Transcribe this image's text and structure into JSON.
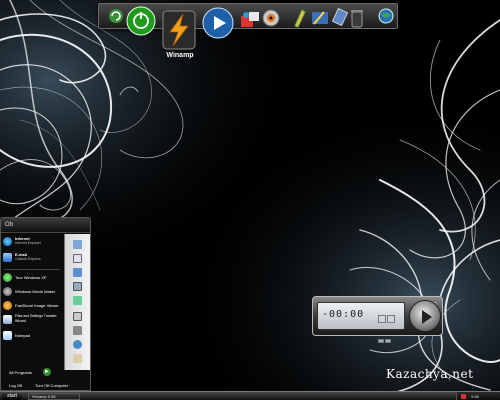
{
  "dock": {
    "label": "Winamp",
    "icons": [
      "refresh-icon",
      "green-orb-icon",
      "winamp-icon",
      "play-icon",
      "paint-icon",
      "cd-icon",
      "pencil-icon",
      "tools-icon",
      "usb-icon",
      "trash-icon",
      "globe-icon"
    ]
  },
  "start_menu": {
    "user_label": "Ob",
    "pinned": [
      {
        "title": "Internet",
        "subtitle": "Internet Explorer",
        "icon": "internet-explorer-icon"
      },
      {
        "title": "E-mail",
        "subtitle": "Outlook Express",
        "icon": "outlook-express-icon"
      }
    ],
    "recent": [
      {
        "label": "Tour Windows XP",
        "icon": "tour-icon"
      },
      {
        "label": "Windows Movie Maker",
        "icon": "movie-maker-icon"
      },
      {
        "label": "FastStone Image Viewer",
        "icon": "faststone-icon"
      },
      {
        "label": "Files and Settings Transfer Wizard",
        "icon": "transfer-wizard-icon"
      },
      {
        "label": "Notepad",
        "icon": "notepad-icon"
      }
    ],
    "all_programs": "All Programs",
    "log_off": "Log Off",
    "turn_off": "Turn Off Computer"
  },
  "player": {
    "time": "-00:00"
  },
  "taskbar": {
    "start_label": "start",
    "task_label": "Winamp 5.56",
    "clock": "9:56"
  },
  "watermark": "Kazachya.net",
  "colors": {
    "background": "#000000",
    "swirl": "#ffffff",
    "glow": "#bfe6ff"
  }
}
